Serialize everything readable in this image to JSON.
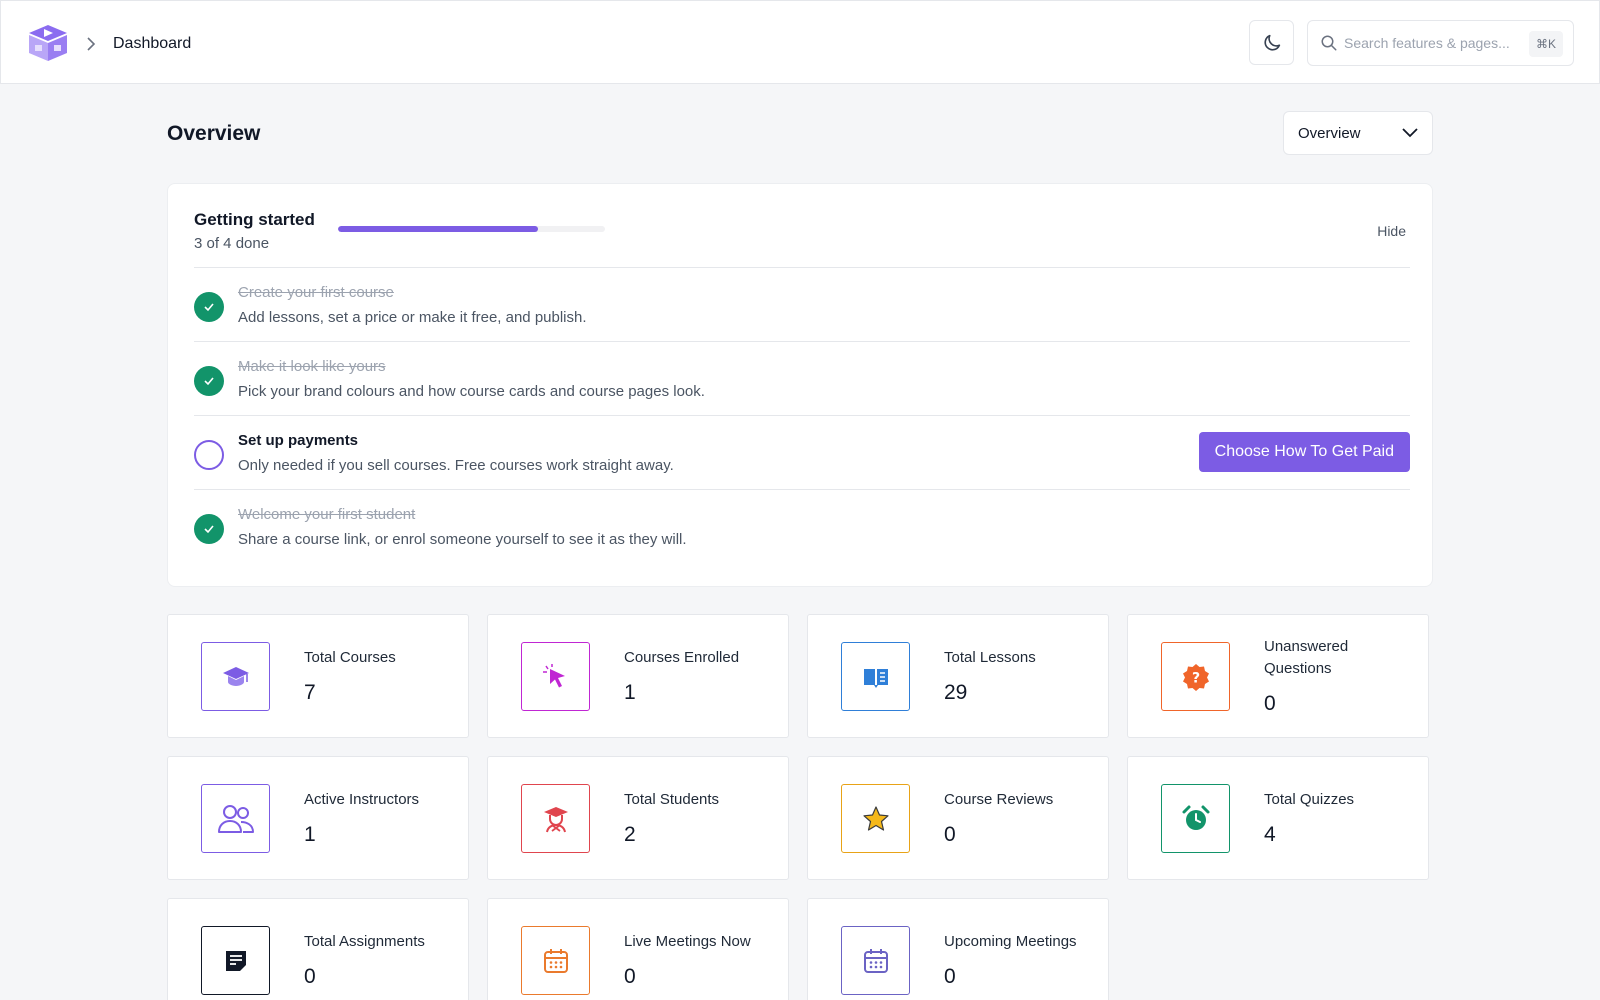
{
  "header": {
    "breadcrumb_current": "Dashboard",
    "search_placeholder": "Search features & pages...",
    "search_shortcut": "⌘K"
  },
  "page": {
    "title": "Overview",
    "view_select": "Overview"
  },
  "getting_started": {
    "title": "Getting started",
    "progress_text": "3 of 4 done",
    "progress_fraction": 0.75,
    "hide_label": "Hide",
    "steps": [
      {
        "title": "Create your first course",
        "description": "Add lessons, set a price or make it free, and publish.",
        "done": true
      },
      {
        "title": "Make it look like yours",
        "description": "Pick your brand colours and how course cards and course pages look.",
        "done": true
      },
      {
        "title": "Set up payments",
        "description": "Only needed if you sell courses. Free courses work straight away.",
        "done": false,
        "action_label": "Choose How To Get Paid"
      },
      {
        "title": "Welcome your first student",
        "description": "Share a course link, or enrol someone yourself to see it as they will.",
        "done": true
      }
    ]
  },
  "stats": [
    {
      "label": "Total Courses",
      "value": "7",
      "icon": "graduation-cap-icon",
      "color": "#7c5ce4"
    },
    {
      "label": "Courses Enrolled",
      "value": "1",
      "icon": "cursor-click-icon",
      "color": "#c026d3"
    },
    {
      "label": "Total Lessons",
      "value": "29",
      "icon": "book-open-icon",
      "color": "#2f7fd8"
    },
    {
      "label": "Unanswered Questions",
      "value": "0",
      "icon": "question-badge-icon",
      "color": "#f0652a"
    },
    {
      "label": "Active Instructors",
      "value": "1",
      "icon": "users-icon",
      "color": "#7c5ce4"
    },
    {
      "label": "Total Students",
      "value": "2",
      "icon": "student-icon",
      "color": "#e0454e"
    },
    {
      "label": "Course Reviews",
      "value": "0",
      "icon": "star-icon",
      "color": "#e8a317"
    },
    {
      "label": "Total Quizzes",
      "value": "4",
      "icon": "alarm-clock-icon",
      "color": "#12946a"
    },
    {
      "label": "Total Assignments",
      "value": "0",
      "icon": "assignment-icon",
      "color": "#111827"
    },
    {
      "label": "Live Meetings Now",
      "value": "0",
      "icon": "calendar-icon",
      "color": "#ea7a2d"
    },
    {
      "label": "Upcoming Meetings",
      "value": "0",
      "icon": "calendar-icon",
      "color": "#6b63c4"
    }
  ]
}
